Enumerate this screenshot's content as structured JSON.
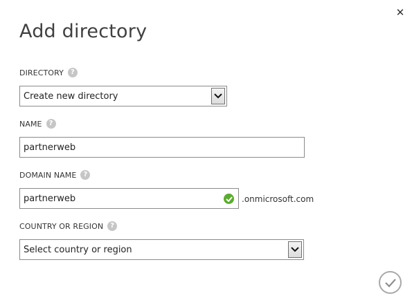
{
  "dialog": {
    "title": "Add directory",
    "close_glyph": "✕"
  },
  "fields": {
    "directory": {
      "label": "DIRECTORY",
      "help_glyph": "?",
      "selected": "Create new directory"
    },
    "name": {
      "label": "NAME",
      "help_glyph": "?",
      "value": "partnerweb"
    },
    "domain_name": {
      "label": "DOMAIN NAME",
      "help_glyph": "?",
      "value": "partnerweb",
      "suffix": ".onmicrosoft.com",
      "status": "valid"
    },
    "country": {
      "label": "COUNTRY OR REGION",
      "help_glyph": "?",
      "selected": "Select country or region"
    }
  },
  "icons": {
    "close": "close-icon",
    "help": "question-mark-icon",
    "dropdown": "chevron-down-icon",
    "valid": "checkmark-icon",
    "submit": "checkmark-icon"
  },
  "colors": {
    "valid_green": "#5cab2e",
    "help_gray": "#c6c6c6",
    "submit_ring": "#a8a8a8"
  }
}
